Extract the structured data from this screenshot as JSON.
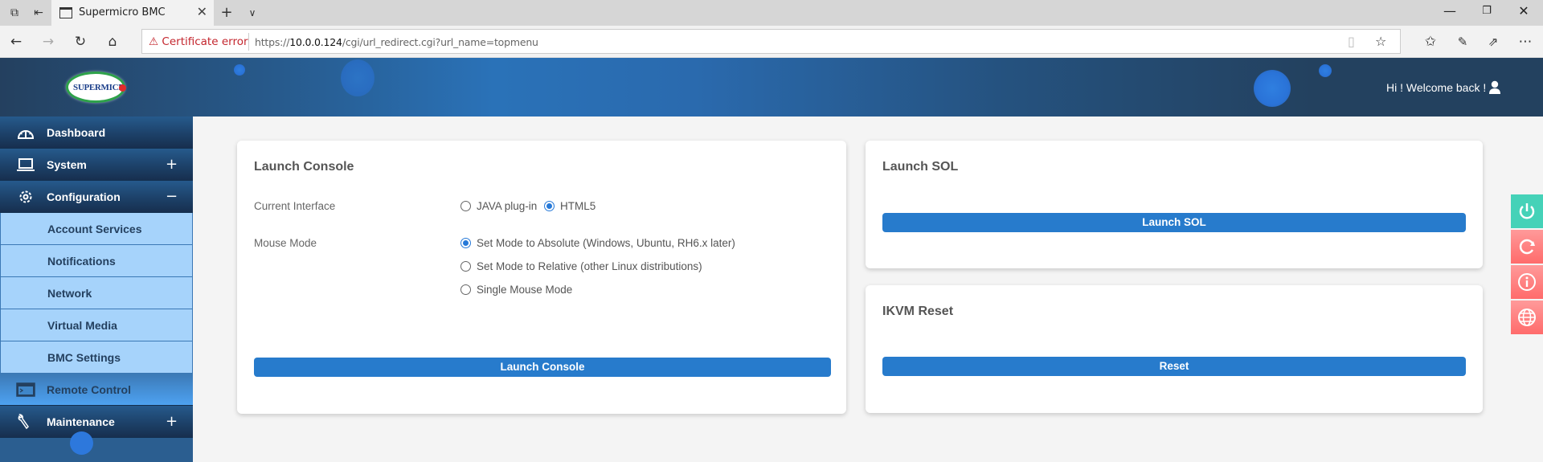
{
  "browser": {
    "tab_title": "Supermicro BMC",
    "cert_warning": "Certificate error",
    "url_prefix": "https://",
    "url_host": "10.0.0.124",
    "url_path": "/cgi/url_redirect.cgi?url_name=topmenu",
    "icons": {
      "tab_list": "tab-list-icon",
      "set_aside": "set-aside-tabs-icon",
      "back": "back-arrow-icon",
      "forward": "forward-arrow-icon",
      "refresh": "refresh-icon",
      "home": "home-icon",
      "reading_view": "reading-view-icon",
      "favorite": "star-icon",
      "favorites_hub": "favorites-list-icon",
      "notes": "pen-icon",
      "share": "share-icon",
      "more": "more-icon"
    }
  },
  "header": {
    "logo_text": "SUPERMICR",
    "welcome": "Hi ! Welcome back !"
  },
  "sidebar": {
    "items": [
      {
        "label": "Dashboard",
        "icon": "dashboard-gauge-icon",
        "toggle": ""
      },
      {
        "label": "System",
        "icon": "laptop-icon",
        "toggle": "+"
      },
      {
        "label": "Configuration",
        "icon": "gear-icon",
        "toggle": "−"
      },
      {
        "label": "Remote Control",
        "icon": "terminal-icon",
        "toggle": ""
      },
      {
        "label": "Maintenance",
        "icon": "wrench-icon",
        "toggle": "+"
      }
    ],
    "configuration_sub": [
      {
        "label": "Account Services"
      },
      {
        "label": "Notifications"
      },
      {
        "label": "Network"
      },
      {
        "label": "Virtual Media"
      },
      {
        "label": "BMC Settings"
      }
    ]
  },
  "launch_console": {
    "title": "Launch Console",
    "interface_label": "Current Interface",
    "interface_options": [
      {
        "label": "JAVA plug-in",
        "selected": false
      },
      {
        "label": "HTML5",
        "selected": true
      }
    ],
    "mouse_label": "Mouse Mode",
    "mouse_options": [
      {
        "label": "Set Mode to Absolute (Windows, Ubuntu, RH6.x later)",
        "selected": true
      },
      {
        "label": "Set Mode to Relative (other Linux distributions)",
        "selected": false
      },
      {
        "label": "Single Mouse Mode",
        "selected": false
      }
    ],
    "button": "Launch Console"
  },
  "launch_sol": {
    "title": "Launch SOL",
    "button": "Launch SOL"
  },
  "ikvm_reset": {
    "title": "IKVM Reset",
    "button": "Reset"
  },
  "quick_actions": [
    {
      "name": "power",
      "icon": "power-icon",
      "color": "#45d2b8"
    },
    {
      "name": "refresh",
      "icon": "refresh-icon",
      "color": "#ff7a7a"
    },
    {
      "name": "info",
      "icon": "info-icon",
      "color": "#ff7a7a"
    },
    {
      "name": "language",
      "icon": "globe-icon",
      "color": "#ff7a7a"
    }
  ],
  "colors": {
    "primary_button": "#277bcc",
    "submenu_bg": "#a6d3fb",
    "header_dark": "#23415f"
  }
}
